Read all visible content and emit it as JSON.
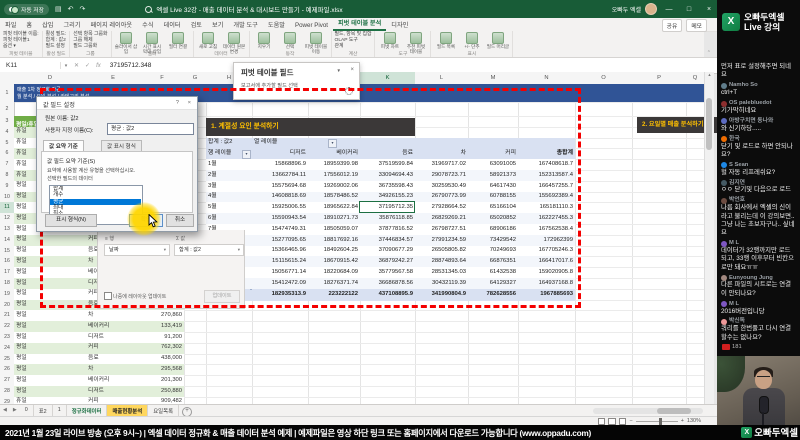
{
  "excel": {
    "titlebar": {
      "autosave": "자동 저장",
      "title": "엑셀 Live 32강 - 매출 데이터 분석 & 대시보드 만들기 - 예제파일.xlsx",
      "account": "오빠두 엑셀",
      "win_buttons": [
        "—",
        "□",
        "×"
      ]
    },
    "ribbon": {
      "tabs": [
        "파일",
        "홈",
        "삽입",
        "그리기",
        "페이지 레이아웃",
        "수식",
        "데이터",
        "검토",
        "보기",
        "개발 도구",
        "도움말",
        "Power Pivot",
        "피벗 테이블 분석",
        "디자인"
      ],
      "active_tab": "피벗 테이블 분석",
      "share": "공유",
      "memo": "메모",
      "groups": [
        {
          "label": "피벗 테이블",
          "style": "stack",
          "items": [
            "피벗 테이블 이름:",
            "피벗 테이블1",
            "옵션 ▾"
          ]
        },
        {
          "label": "활성 필드",
          "style": "stack",
          "items": [
            "활성 필드:",
            "합계 : 값2",
            "필드 설정"
          ]
        },
        {
          "label": "그룹",
          "style": "stack",
          "items": [
            "선택 항목 그룹화",
            "그룹 해제",
            "필드 그룹화"
          ]
        },
        {
          "label": "필터",
          "style": "big",
          "items": [
            "슬라이서 삽입",
            "시간 표시 막대 삽입",
            "필터 연결"
          ]
        },
        {
          "label": "데이터",
          "style": "big",
          "items": [
            "새로 고침",
            "데이터 원본 변경"
          ]
        },
        {
          "label": "동작",
          "style": "big",
          "items": [
            "지우기",
            "선택",
            "피벗 테이블 이동"
          ]
        },
        {
          "label": "계산",
          "style": "stack",
          "items": [
            "필드, 항목 및 집합",
            "OLAP 도구",
            "관계"
          ]
        },
        {
          "label": "도구",
          "style": "big",
          "items": [
            "피벗 차트",
            "추천 피벗 테이블"
          ]
        },
        {
          "label": "표시",
          "style": "big",
          "items": [
            "필드 목록",
            "+/- 단추",
            "필드 머리글"
          ]
        }
      ]
    },
    "formula": {
      "name_box": "K11",
      "value": "37195712.348"
    },
    "columns": [
      "D",
      "E",
      "F",
      "G",
      "H",
      "I",
      "J",
      "K",
      "L",
      "M",
      "N",
      "O",
      "P",
      "Q"
    ],
    "selected_col": "K",
    "selected_row": 11,
    "d1_lines": [
      "매출 1차 정규화 가공",
      "월 분석 / 요일 분석 / 카테고리 분석"
    ],
    "left_table": {
      "header": "평일/휴일",
      "rows": [
        [
          4,
          "휴일",
          "",
          ""
        ],
        [
          5,
          "휴일",
          "",
          ""
        ],
        [
          6,
          "휴일",
          "",
          ""
        ],
        [
          7,
          "휴일",
          "",
          ""
        ],
        [
          8,
          "휴일",
          "",
          ""
        ],
        [
          9,
          "평일",
          "",
          ""
        ],
        [
          10,
          "평일",
          "",
          ""
        ],
        [
          11,
          "평일",
          "",
          ""
        ],
        [
          12,
          "평일",
          "",
          ""
        ],
        [
          13,
          "평일",
          "디저트",
          ""
        ],
        [
          14,
          "평일",
          "커피",
          ""
        ],
        [
          15,
          "평일",
          "음료",
          ""
        ],
        [
          16,
          "평일",
          "차",
          ""
        ],
        [
          17,
          "평일",
          "베이커리",
          ""
        ],
        [
          18,
          "평일",
          "디저트",
          ""
        ],
        [
          19,
          "평일",
          "커피",
          ""
        ],
        [
          20,
          "평일",
          "음료",
          "272,860"
        ],
        [
          21,
          "평일",
          "차",
          "270,860"
        ],
        [
          22,
          "평일",
          "베이커리",
          "133,419"
        ],
        [
          23,
          "평일",
          "디저트",
          "91,200"
        ],
        [
          24,
          "평일",
          "커피",
          "762,302"
        ],
        [
          25,
          "평일",
          "음료",
          "438,000"
        ],
        [
          26,
          "평일",
          "차",
          "295,568"
        ],
        [
          27,
          "평일",
          "베이커리",
          "201,300"
        ],
        [
          28,
          "평일",
          "디저트",
          "250,880"
        ],
        [
          29,
          "휴일",
          "커피",
          "909,482"
        ]
      ]
    },
    "sections": {
      "s1": "1. 계절성 요인 분석하기",
      "s2": "2. 요일별 매출 분석하기"
    },
    "pivot": {
      "corner": "합계 : 값2",
      "col_header": "열 레이블",
      "row_header": "행 레이블",
      "columns": [
        "디저트",
        "베이커리",
        "음료",
        "차",
        "커피",
        "총합계"
      ],
      "rows": [
        {
          "label": "1월",
          "values": [
            "15868896.9",
            "18959399.98",
            "37519599.84",
            "31969717.02",
            "63091005",
            "167408618.7"
          ]
        },
        {
          "label": "2월",
          "values": [
            "13662784.11",
            "17556012.19",
            "33094694.43",
            "29078723.71",
            "58921373",
            "152313587.4"
          ]
        },
        {
          "label": "3월",
          "values": [
            "15575694.68",
            "19269002.06",
            "36735598.43",
            "30259530.49",
            "64617430",
            "166457255.7"
          ]
        },
        {
          "label": "4월",
          "values": [
            "14608818.69",
            "18578486.52",
            "34926155.23",
            "26790773.99",
            "60788155",
            "155692389.4"
          ]
        },
        {
          "label": "5월",
          "values": [
            "15925006.55",
            "18965622.84",
            "37195712.35",
            "27928664.52",
            "65166104",
            "165181110.3"
          ]
        },
        {
          "label": "6월",
          "values": [
            "15590943.54",
            "18910271.73",
            "35876118.85",
            "26829269.21",
            "65020852",
            "162227455.3"
          ]
        },
        {
          "label": "7월",
          "values": [
            "15474749.31",
            "18505059.07",
            "37877816.52",
            "26798727.51",
            "68906186",
            "167562538.4"
          ]
        },
        {
          "label": "8월",
          "values": [
            "15277095.65",
            "18817692.16",
            "37446834.57",
            "27991234.59",
            "73429542",
            "172962399"
          ]
        },
        {
          "label": "9월",
          "values": [
            "15366465.96",
            "18492604.25",
            "37090677.29",
            "26505805.82",
            "70249693",
            "167705246.3"
          ]
        },
        {
          "label": "10월",
          "values": [
            "15115615.24",
            "18670915.42",
            "36879242.27",
            "28874893.64",
            "66876351",
            "166417017.6"
          ]
        },
        {
          "label": "11월",
          "values": [
            "15056771.14",
            "18220684.09",
            "35779567.58",
            "28531345.03",
            "61432538",
            "159020905.8"
          ]
        },
        {
          "label": "12월",
          "values": [
            "15412472.09",
            "18276371.74",
            "36686878.56",
            "30432119.39",
            "64129327",
            "164937168.8"
          ]
        }
      ],
      "total": {
        "label": "총합계",
        "values": [
          "182935313.9",
          "223222122",
          "437108895.9",
          "341990804.9",
          "782628556",
          "1967885693"
        ]
      },
      "selected": {
        "row": "5월",
        "col": "음료"
      }
    },
    "dialog": {
      "title": "값 필드 설정",
      "source_label": "원본 이름: 값2",
      "custom_name_label": "사용자 지정 이름(C):",
      "custom_name_value": "평균 : 값2",
      "tabs": [
        "값 요약 기준",
        "값 표시 형식"
      ],
      "active_tab": "값 요약 기준",
      "group_label": "값 필드 요약 기준(S)",
      "desc1": "요약에 사용할 계산 유형을 선택하십시오.",
      "desc2": "선택한 필드의 데이터",
      "options": [
        "합계",
        "개수",
        "평균",
        "최대",
        "최소",
        "곱"
      ],
      "selected_option": "평균",
      "number_format": "표시 형식(N)",
      "ok": "확인",
      "cancel": "취소"
    },
    "fields_pane": {
      "title": "피벗 테이블 필드",
      "subtitle": "보고서에 추가할 필드 선택",
      "rows_label": "행",
      "values_label": "값",
      "rows_chip": "날짜",
      "values_chip": "합계 : 값2",
      "defer_label": "나중에 레이아웃 업데이트",
      "update_btn": "업데이트"
    },
    "sheet_tabs": [
      "0",
      "표2",
      "1",
      "정규화데이터",
      "매출현황분석",
      "요일목록"
    ],
    "active_sheet": "매출현황분석",
    "green_sheet": "정규화데이터",
    "status": {
      "zoom": "130%"
    }
  },
  "stream": {
    "brand": "오빠두엑셀",
    "brand_sub": "Live 강의",
    "live_count": "181",
    "watermark": "오빠두엑셀",
    "banner": "2021년 1월 23일 라이브 방송 (오후 9시~) | 엑셀 데이터 정규화 & 매출 데이터 분석 예제 | 예제파일은 영상 하단 링크 또는 홈페이지에서 다운로드 가능합니다 (www.oppadu.com)",
    "chat": [
      {
        "u": "",
        "m": "먼저 표로 설정해주면 되네요",
        "c": "#607d8b"
      },
      {
        "u": "Namho So",
        "m": "ctrl+T",
        "c": "#607d8b"
      },
      {
        "u": "OS palebluedot",
        "m": "기가막히네요",
        "c": "#8d2f2f"
      },
      {
        "u": "아방구치면 동나와",
        "m": "와 신기하당.....",
        "c": "#5c6bc0"
      },
      {
        "u": "한국",
        "m": "닫기 및 로드로 하면 안되나요?",
        "c": "#ef6c00"
      },
      {
        "u": "S Sean",
        "m": "헐 자동 리프레쉬요?",
        "c": "#1e88e5"
      },
      {
        "u": "김지연",
        "m": "ㅇㅇ 닫기및 다음으로 로드",
        "c": "#455a64"
      },
      {
        "u": "박언호",
        "m": "나름 회사에서 엑셀의 신이라고 불리는데 이 강의보면.. 그냥 나는 초보자구나.. 싶네요",
        "c": "#6d4c41"
      },
      {
        "u": "M L",
        "m": "데이터가 32행까지만 로드되고, 33행 이후부터 빈칸으로만 돼요ㅠㅠ",
        "c": "#7e57c2"
      },
      {
        "u": "Eunyoung Jung",
        "m": "다른 파일의 시트로는 연결이 안되나요?",
        "c": "#a1887f"
      },
      {
        "u": "M L",
        "m": "2016버전입니당",
        "c": "#7e57c2"
      },
      {
        "u": "박신독",
        "m": "쿼리를 한번풀고 다시 연결 할수는 없나요?",
        "c": "#ef9a9a"
      }
    ]
  }
}
